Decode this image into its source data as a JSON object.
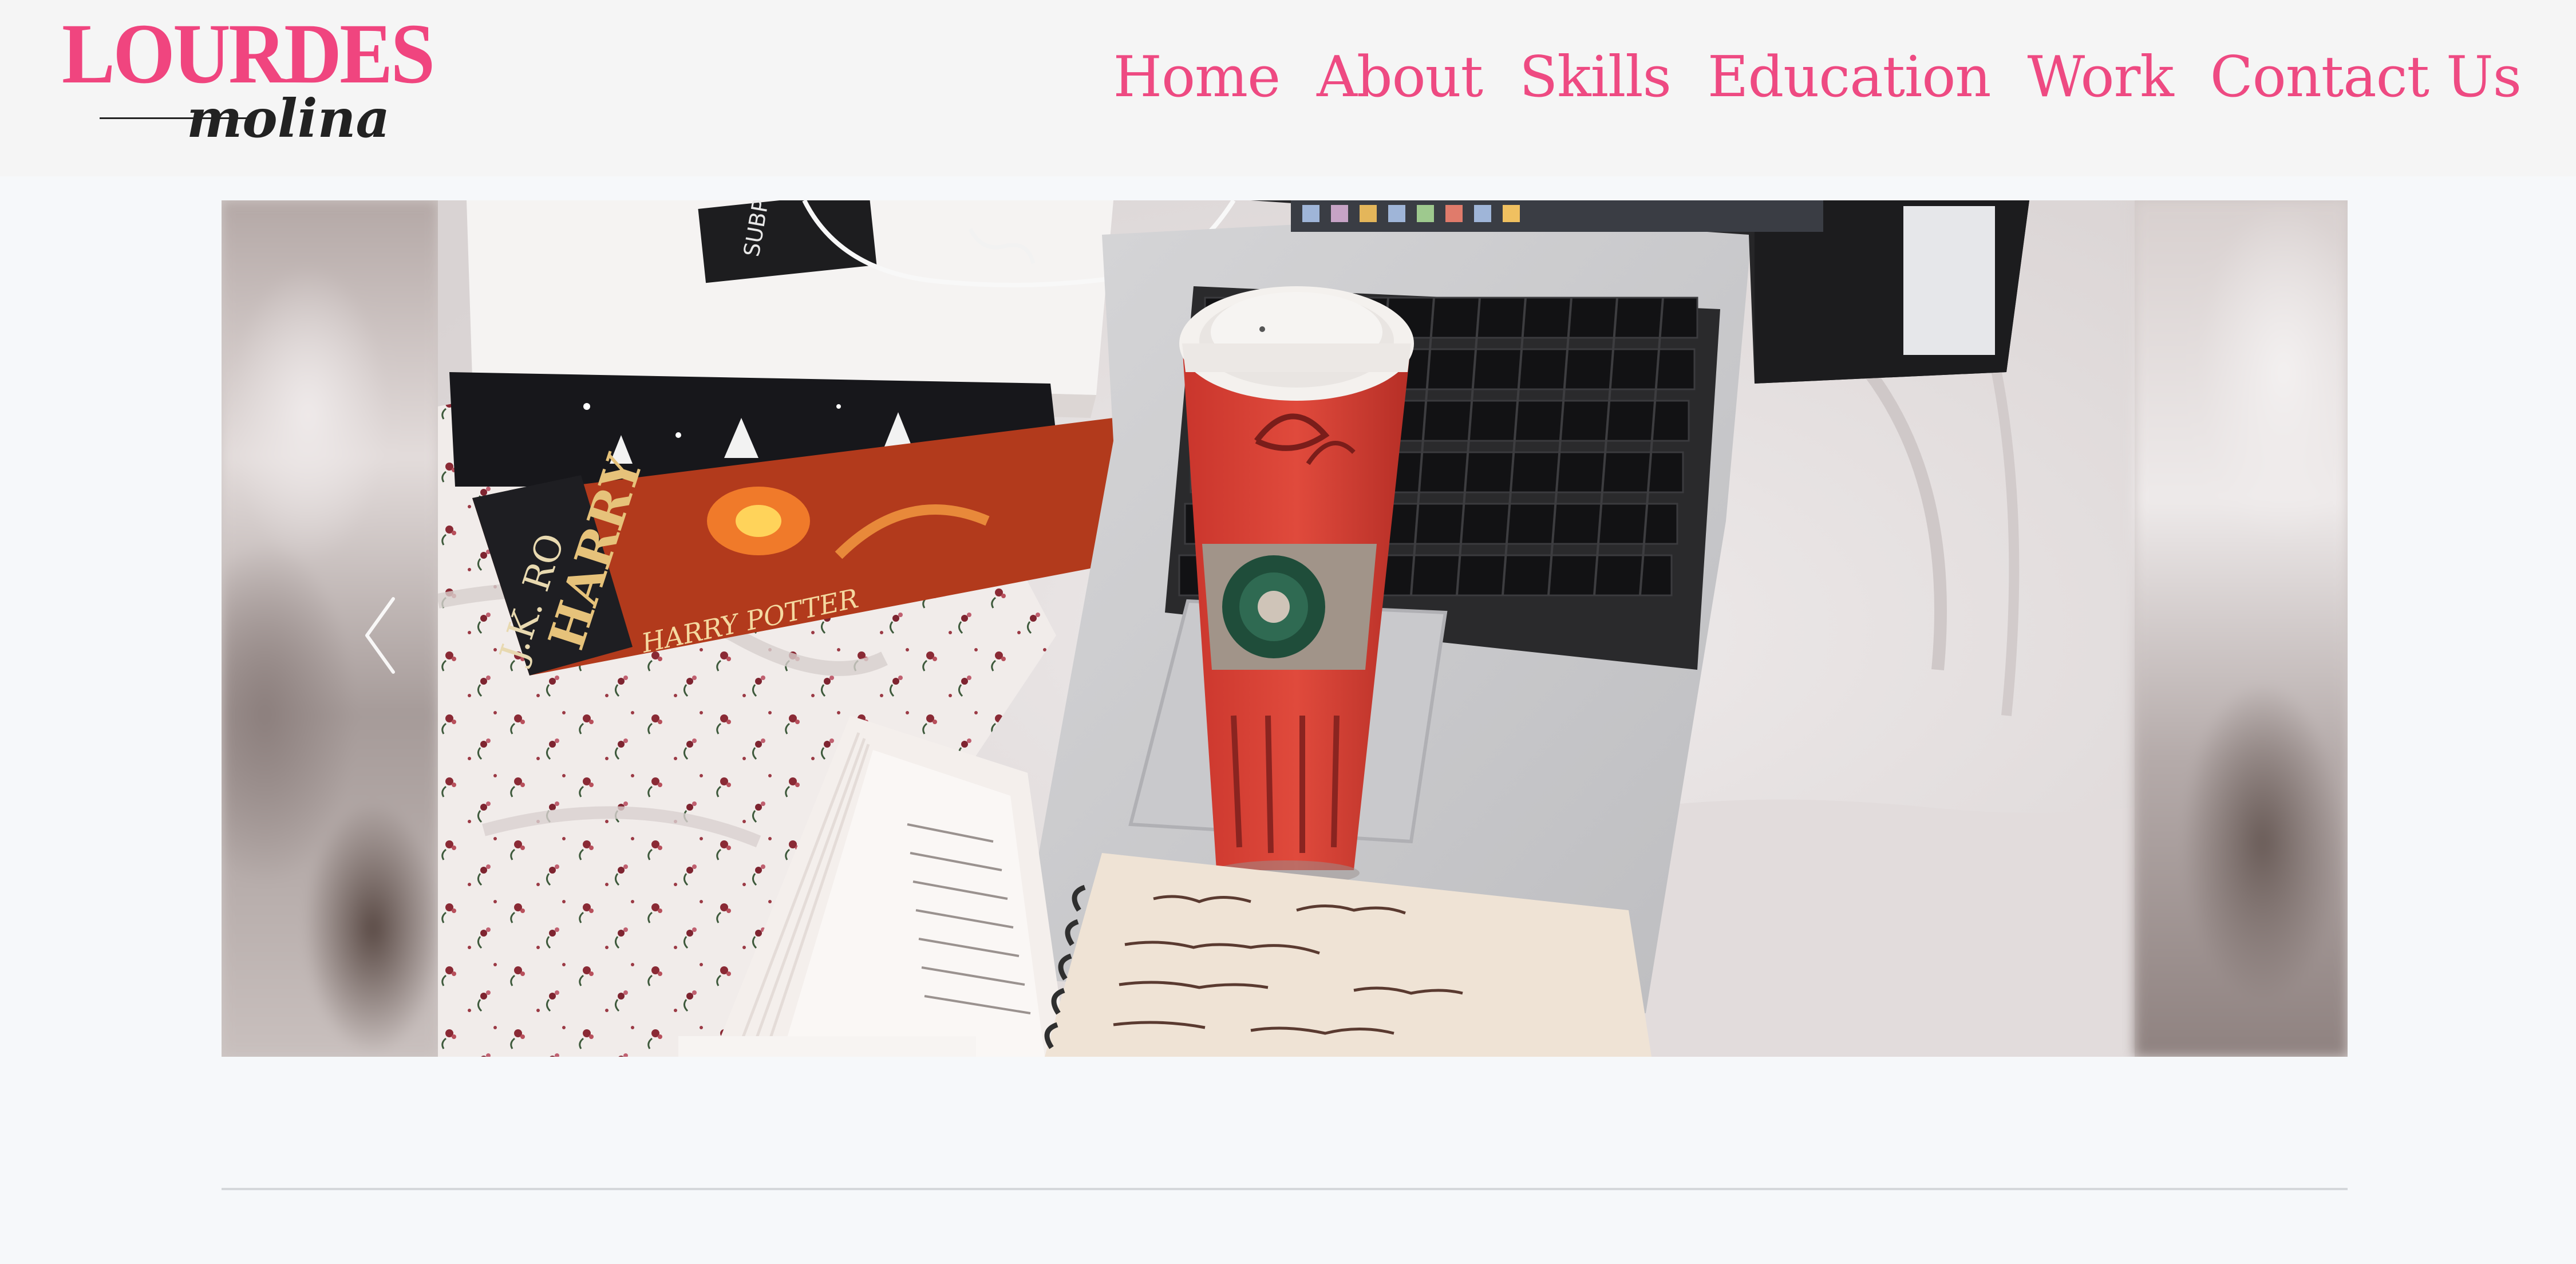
{
  "brand": {
    "logo_top": "LOURDES",
    "logo_bottom": "molina",
    "accent_color": "#ee4a82"
  },
  "nav": {
    "items": [
      {
        "label": "Home"
      },
      {
        "label": "About"
      },
      {
        "label": "Skills"
      },
      {
        "label": "Education"
      },
      {
        "label": "Work"
      },
      {
        "label": "Contact Us"
      }
    ]
  },
  "carousel": {
    "prev_icon": "chevron-left-icon",
    "next_icon": "chevron-right-icon"
  },
  "slide_image": {
    "book_spine_author": "J.K. RO",
    "book_spine_title": "HARRY",
    "book_cover_text": "HARRY POTTER"
  }
}
